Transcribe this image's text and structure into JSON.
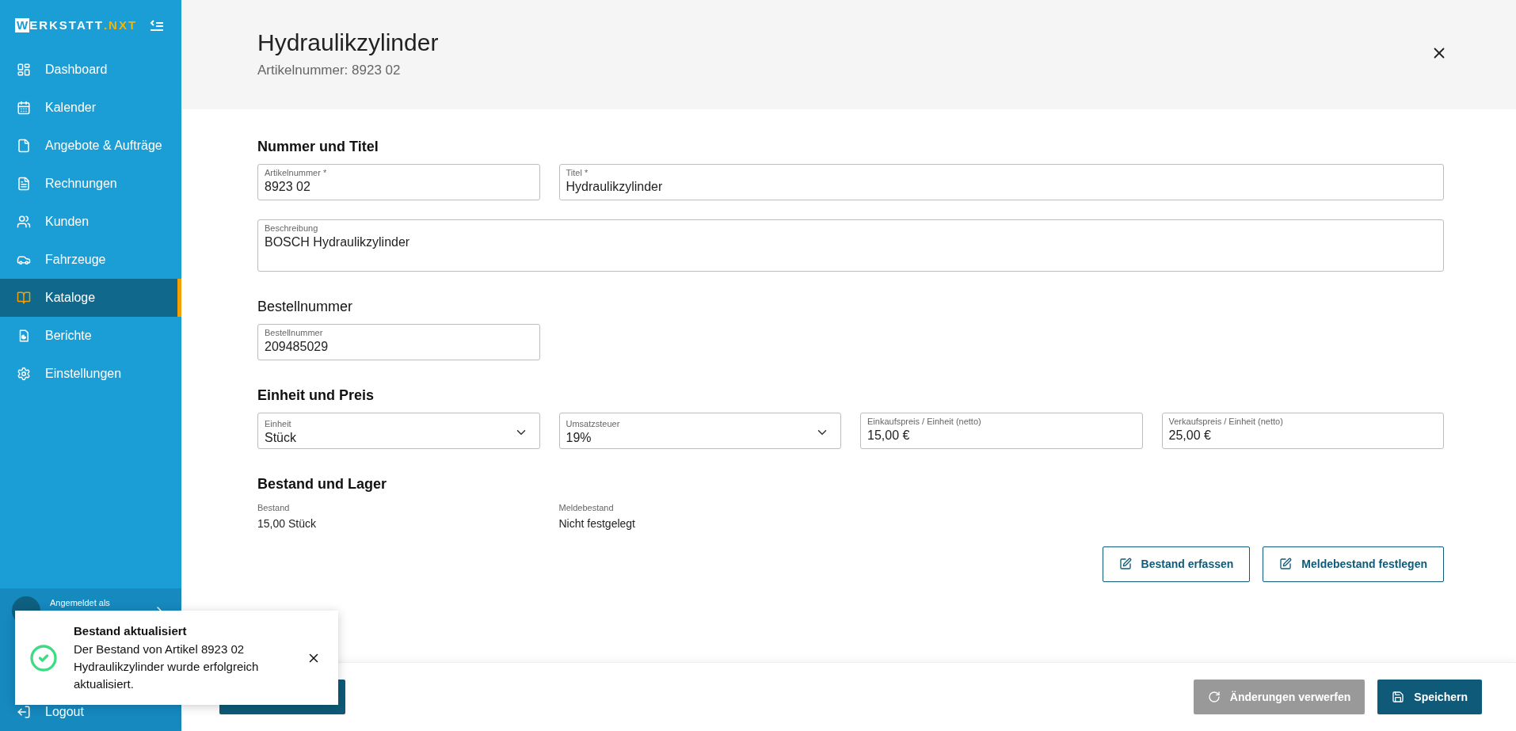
{
  "sidebar": {
    "logo": {
      "mark": "W",
      "name": "ERKSTATT",
      "suffix": ".NXT"
    },
    "items": [
      {
        "label": "Dashboard",
        "selected": false
      },
      {
        "label": "Kalender",
        "selected": false
      },
      {
        "label": "Angebote & Aufträge",
        "selected": false
      },
      {
        "label": "Rechnungen",
        "selected": false
      },
      {
        "label": "Kunden",
        "selected": false
      },
      {
        "label": "Fahrzeuge",
        "selected": false
      },
      {
        "label": "Kataloge",
        "selected": true
      },
      {
        "label": "Berichte",
        "selected": false
      },
      {
        "label": "Einstellungen",
        "selected": false
      }
    ],
    "user": {
      "caption": "Angemeldet als"
    },
    "logout": "Logout"
  },
  "header": {
    "title": "Hydraulikzylinder",
    "subtitle": "Artikelnummer: 8923 02"
  },
  "sections": [
    {
      "heading": "Nummer und Titel",
      "bold": true,
      "fields": [
        {
          "kind": "text",
          "label": "Artikelnummer *",
          "value": "8923 02"
        },
        {
          "kind": "text",
          "label": "Titel *",
          "value": "Hydraulikzylinder"
        },
        {
          "kind": "textarea",
          "label": "Beschreibung",
          "value": "BOSCH Hydraulikzylinder"
        }
      ]
    },
    {
      "heading": "Bestellnummer",
      "bold": false,
      "fields": [
        {
          "kind": "text",
          "label": "Bestellnummer",
          "value": "209485029"
        }
      ]
    },
    {
      "heading": "Einheit und Preis",
      "bold": true,
      "fields": [
        {
          "kind": "select",
          "label": "Einheit",
          "value": "Stück"
        },
        {
          "kind": "select",
          "label": "Umsatzsteuer",
          "value": "19%"
        },
        {
          "kind": "text",
          "label": "Einkaufspreis / Einheit (netto)",
          "value": "15,00 €"
        },
        {
          "kind": "text",
          "label": "Verkaufspreis / Einheit (netto)",
          "value": "25,00 €"
        }
      ]
    },
    {
      "heading": "Bestand und Lager",
      "bold": true,
      "readouts": [
        {
          "label": "Bestand",
          "value": "15,00 Stück"
        },
        {
          "label": "Meldebestand",
          "value": "Nicht festgelegt"
        }
      ],
      "actions": [
        "Bestand erfassen",
        "Meldebestand festlegen"
      ]
    }
  ],
  "footer": {
    "buttons": [
      {
        "kind": "secondary",
        "label": "Änderungen verwerfen"
      },
      {
        "kind": "primary",
        "label": "Speichern"
      }
    ]
  },
  "toast": {
    "kind": "success",
    "title": "Bestand aktualisiert",
    "message": "Der Bestand von Artikel 8923 02 Hydraulikzylinder wurde erfolgreich aktualisiert."
  }
}
